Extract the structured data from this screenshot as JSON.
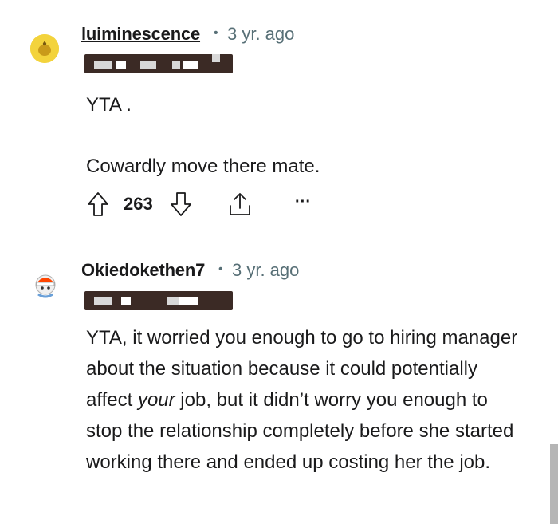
{
  "comments": [
    {
      "username": "luiminescence",
      "time": "3 yr. ago",
      "separator": "•",
      "body": [
        "YTA .",
        "Cowardly move there mate."
      ],
      "votes": "263",
      "more_label": "···",
      "avatar_icon": "snoo-avatar-icon"
    },
    {
      "username": "Okiedokethen7",
      "time": "3 yr. ago",
      "separator": "•",
      "body_before": "YTA, it worried you enough to go to hiring manager about the situation because it could potentially affect ",
      "body_emphasis": "your",
      "body_after": " job, but it didn’t worry you enough to stop the relationship completely before she started working there and ended up costing her the job.",
      "avatar_icon": "snoo-avatar-icon"
    }
  ],
  "colors": {
    "flair_bg": "#3b2a25",
    "meta_text": "#576f76",
    "text": "#1a1a1b"
  }
}
